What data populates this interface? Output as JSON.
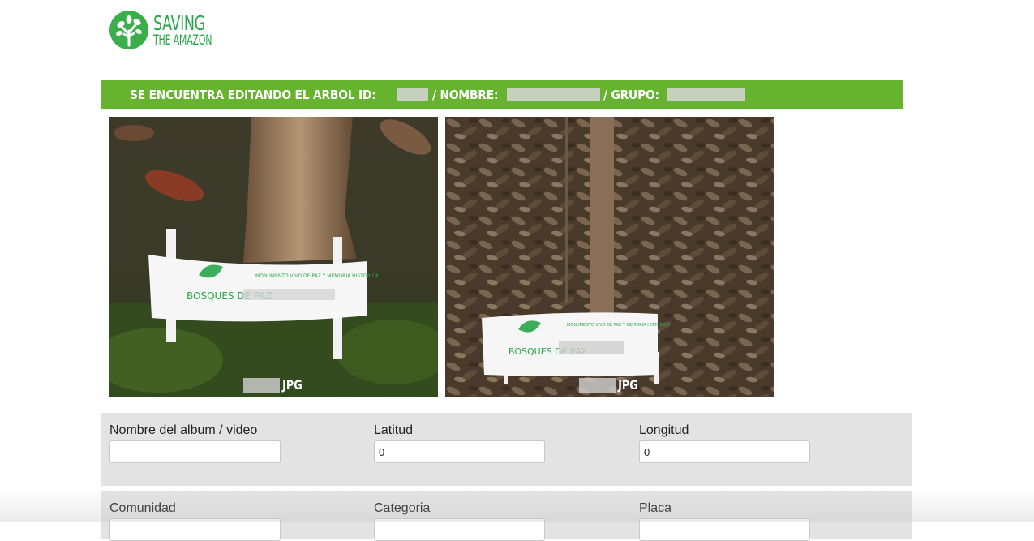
{
  "brand": {
    "line1": "SAVING",
    "line2": "THE AMAZON",
    "color": "#2aa54a"
  },
  "banner": {
    "prefix": "SE ENCUENTRA EDITANDO EL ARBOL ID:",
    "nombre_label": "/ NOMBRE:",
    "grupo_label": "/ GRUPO:",
    "color": "#65b32e"
  },
  "photos": [
    {
      "caption_ext": "JPG",
      "sign_title": "BOSQUES DE PAZ",
      "sign_subtitle": "MONUMENTO VIVO DE PAZ Y MEMORIA HISTÓRICA"
    },
    {
      "caption_ext": "JPG",
      "sign_title": "BOSQUES DE PAZ",
      "sign_subtitle": "MONUMENTO VIVO DE PAZ Y MEMORIA HISTÓRICA"
    }
  ],
  "form": {
    "row1": [
      {
        "label": "Nombre del album / video",
        "value": ""
      },
      {
        "label": "Latitud",
        "value": "0"
      },
      {
        "label": "Longitud",
        "value": "0"
      }
    ],
    "row2": [
      {
        "label": "Comunidad",
        "value": ""
      },
      {
        "label": "Categoria",
        "value": ""
      },
      {
        "label": "Placa",
        "value": ""
      }
    ]
  }
}
